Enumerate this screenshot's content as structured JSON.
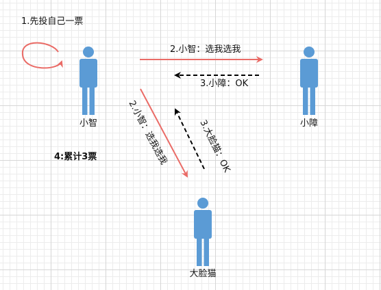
{
  "colors": {
    "person": "#5b9bd5",
    "vote_arrow": "#ea6b66",
    "reply_arrow": "#000000",
    "self_loop": "#ea6b66"
  },
  "nodes": {
    "xiaozhi": "小智",
    "xiaozhang": "小障",
    "dalianmao": "大脸猫"
  },
  "labels": {
    "self_vote": "1.先投自己一票",
    "vote_to_xiaozhang": "2.小智：选我选我",
    "reply_from_xiaozhang": "3.小障：OK",
    "vote_to_dalianmao": "2.小智：选我选我",
    "reply_from_dalianmao": "3.大脸猫：OK",
    "total": "4:累计3票"
  }
}
